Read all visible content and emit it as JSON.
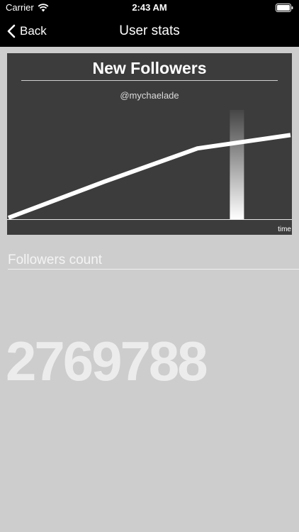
{
  "status_bar": {
    "carrier": "Carrier",
    "time": "2:43 AM",
    "wifi_icon": "wifi-icon",
    "battery_icon": "battery-icon"
  },
  "nav": {
    "back_label": "Back",
    "back_icon": "chevron-left-icon",
    "title": "User stats"
  },
  "chart": {
    "title": "New Followers",
    "subtitle": "@mychaelade",
    "x_axis_label": "time"
  },
  "chart_data": {
    "type": "line",
    "title": "New Followers",
    "subtitle": "@mychaelade",
    "xlabel": "time",
    "ylabel": "",
    "series": [
      {
        "values": [
          0,
          0.38,
          0.73,
          0.87
        ]
      }
    ],
    "x": [
      0,
      0.34,
      0.67,
      1.0
    ],
    "ylim": [
      0,
      1
    ],
    "grid": false,
    "highlight_x": 0.81,
    "colors": {
      "background": "#3c3c3c",
      "line": "#ffffff"
    }
  },
  "stats": {
    "label": "Followers count",
    "value": "2769788"
  },
  "colors": {
    "page_background": "#cdcdcd",
    "bars": "#000000",
    "count_text": "#ececec"
  }
}
